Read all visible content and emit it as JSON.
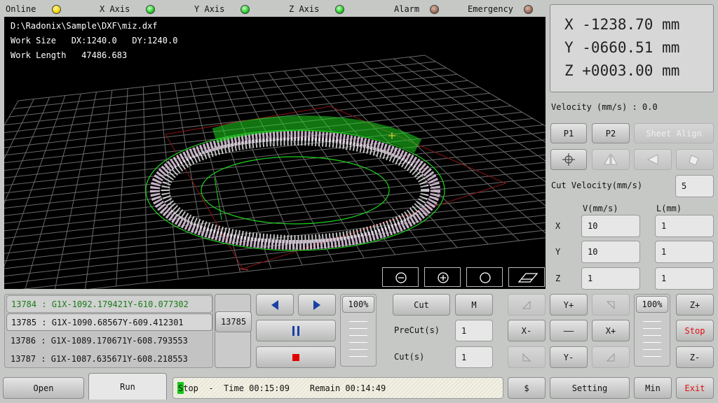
{
  "status_bar": {
    "online": "Online",
    "x_axis": "X Axis",
    "y_axis": "Y Axis",
    "z_axis": "Z Axis",
    "alarm": "Alarm",
    "emergency": "Emergency"
  },
  "viewport": {
    "file_path": "D:\\Radonix\\Sample\\DXF\\miz.dxf",
    "work_size": "Work Size   DX:1240.0   DY:1240.0",
    "work_length": "Work Length   47486.683",
    "zoom_icons": [
      "zoom-out-icon",
      "zoom-in-icon",
      "zoom-fit-icon",
      "eraser-icon"
    ]
  },
  "coords": {
    "x": "X -1238.70 mm",
    "y": "Y -0660.51 mm",
    "z": "Z +0003.00 mm"
  },
  "velocity_label": "Velocity (mm/s) : 0.0",
  "buttons": {
    "p1": "P1",
    "p2": "P2",
    "sheet_align": "Sheet Align"
  },
  "cut_velocity": {
    "label": "Cut Velocity(mm/s)",
    "value": "5"
  },
  "jog_table": {
    "col_v": "V(mm/s)",
    "col_l": "L(mm)",
    "rows": [
      {
        "axis": "X",
        "v": "10",
        "l": "1"
      },
      {
        "axis": "Y",
        "v": "10",
        "l": "1"
      },
      {
        "axis": "Z",
        "v": "1",
        "l": "1"
      }
    ]
  },
  "gcode": {
    "lines": [
      "13784 : G1X-1092.179421Y-610.077302",
      "13785 : G1X-1090.68567Y-609.412301",
      "13786 : G1X-1089.170671Y-608.793553",
      "13787 : G1X-1087.635671Y-608.218553"
    ],
    "current_line": "13785"
  },
  "feed_override": "100%",
  "jog_override": "100%",
  "cut_panel": {
    "cut": "Cut",
    "m": "M",
    "precut_label": "PreCut(s)",
    "precut_value": "1",
    "cut_label": "Cut(s)",
    "cut_value": "1"
  },
  "jog_buttons": {
    "y_plus": "Y+",
    "x_minus": "X-",
    "x_plus": "X+",
    "y_minus": "Y-",
    "z_plus": "Z+",
    "z_minus": "Z-",
    "stop": "Stop",
    "center": "——"
  },
  "bottom": {
    "open": "Open",
    "run": "Run",
    "status_stop": "Stop",
    "status_time": "  -  Time 00:15:09    Remain 00:14:49",
    "dollar": "$",
    "setting": "Setting",
    "min": "Min",
    "exit": "Exit"
  },
  "colors": {
    "led_online": "#f2d300",
    "led_axis": "#22cc22",
    "led_alarm": "#9a6a58",
    "active_gcode": "#1a7a1a",
    "danger_text": "#e01010",
    "play_blue": "#1a3fa8",
    "stop_red": "#e00000"
  }
}
